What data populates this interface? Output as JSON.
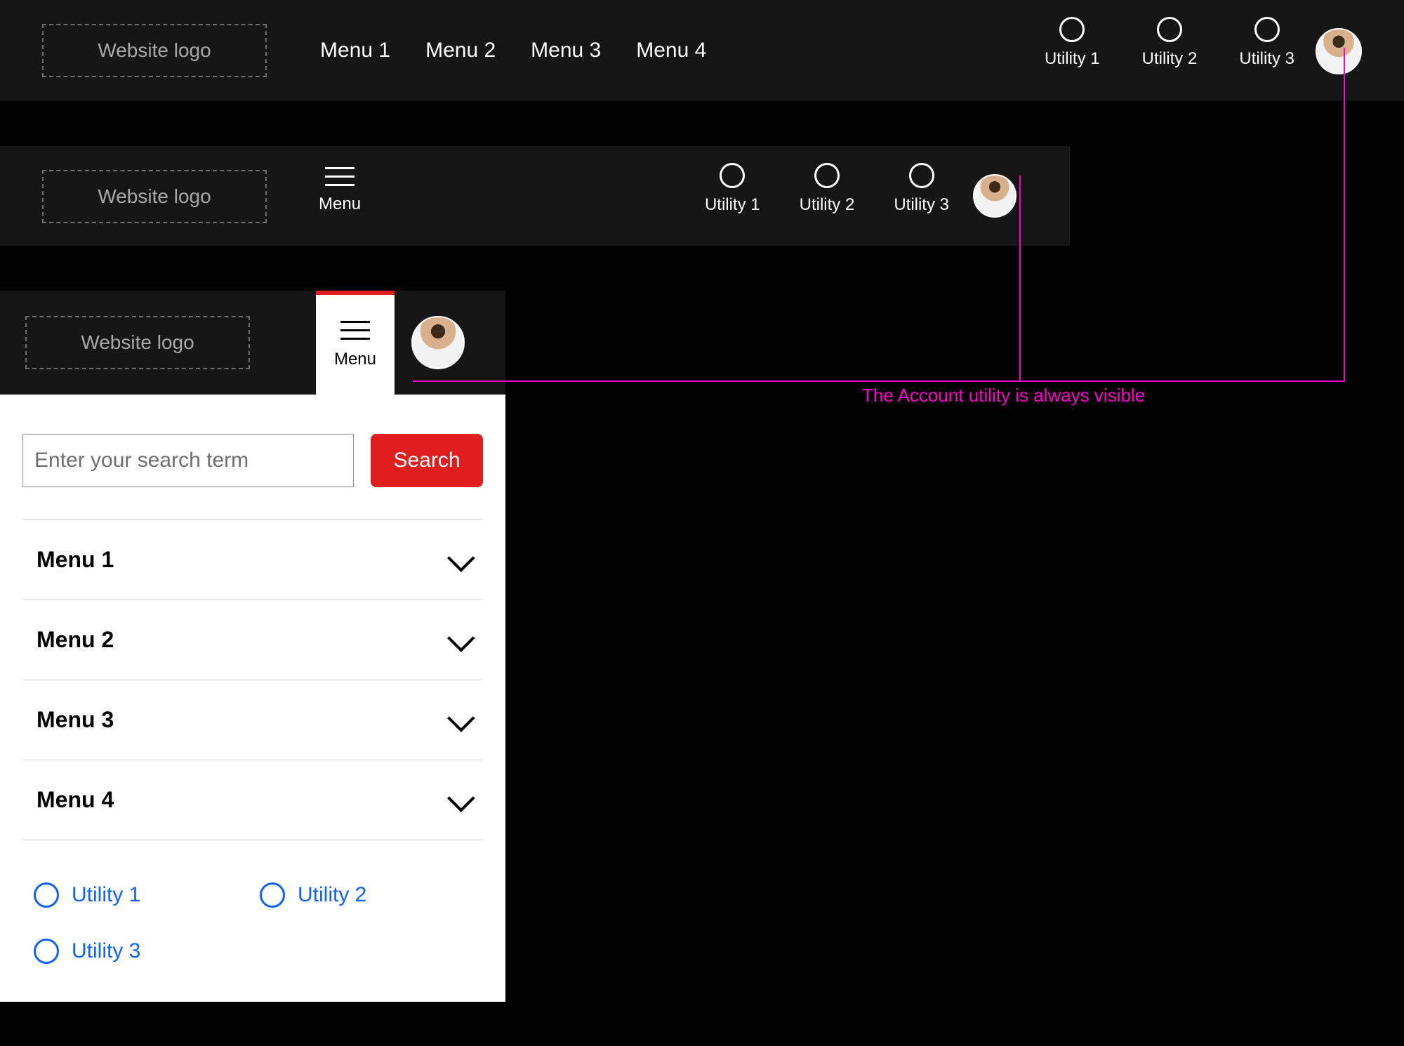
{
  "logo_label": "Website logo",
  "menu_button_label": "Menu",
  "desktop": {
    "menus": [
      "Menu 1",
      "Menu 2",
      "Menu 3",
      "Menu 4"
    ],
    "utilities": [
      "Utility 1",
      "Utility 2",
      "Utility 3"
    ]
  },
  "tablet": {
    "utilities": [
      "Utility 1",
      "Utility 2",
      "Utility 3"
    ]
  },
  "mobile": {
    "search_placeholder": "Enter your search term",
    "search_button": "Search",
    "menus": [
      "Menu 1",
      "Menu 2",
      "Menu 3",
      "Menu 4"
    ],
    "utilities": [
      "Utility 1",
      "Utility 2",
      "Utility 3"
    ]
  },
  "annotation": "The Account utility is always visible"
}
